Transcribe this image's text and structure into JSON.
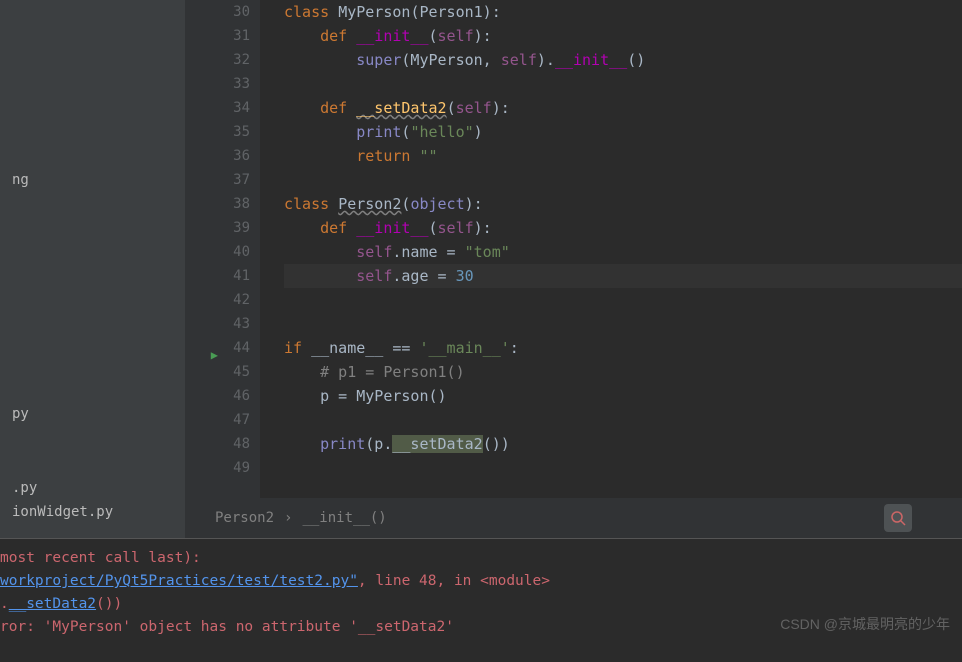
{
  "sidebar": {
    "items": [
      "",
      "",
      "",
      "",
      "",
      "",
      "",
      "ng",
      "",
      "",
      "",
      "",
      "",
      "",
      "",
      "",
      "",
      "py",
      "",
      "",
      ".py",
      "ionWidget.py"
    ]
  },
  "gutter": {
    "lines": [
      "30",
      "31",
      "32",
      "33",
      "34",
      "35",
      "36",
      "37",
      "38",
      "39",
      "40",
      "41",
      "42",
      "43",
      "44",
      "45",
      "46",
      "47",
      "48",
      "49"
    ]
  },
  "code": {
    "lines": [
      {
        "n": 30,
        "tokens": [
          {
            "t": "class ",
            "c": "keyword"
          },
          {
            "t": "MyPerson",
            "c": "class-name"
          },
          {
            "t": "(Person1):",
            "c": "paren"
          }
        ]
      },
      {
        "n": 31,
        "tokens": [
          {
            "t": "    ",
            "c": ""
          },
          {
            "t": "def ",
            "c": "keyword"
          },
          {
            "t": "__init__",
            "c": "dunder"
          },
          {
            "t": "(",
            "c": "paren"
          },
          {
            "t": "self",
            "c": "self-param"
          },
          {
            "t": "):",
            "c": "paren"
          }
        ]
      },
      {
        "n": 32,
        "tokens": [
          {
            "t": "        ",
            "c": ""
          },
          {
            "t": "super",
            "c": "builtin"
          },
          {
            "t": "(MyPerson, ",
            "c": "paren"
          },
          {
            "t": "self",
            "c": "self-param"
          },
          {
            "t": ").",
            "c": "paren"
          },
          {
            "t": "__init__",
            "c": "dunder"
          },
          {
            "t": "()",
            "c": "paren"
          }
        ]
      },
      {
        "n": 33,
        "tokens": []
      },
      {
        "n": 34,
        "tokens": [
          {
            "t": "    ",
            "c": ""
          },
          {
            "t": "def ",
            "c": "keyword"
          },
          {
            "t": "__setData2",
            "c": "method-name underline-wavy"
          },
          {
            "t": "(",
            "c": "paren"
          },
          {
            "t": "self",
            "c": "self-param"
          },
          {
            "t": "):",
            "c": "paren"
          }
        ]
      },
      {
        "n": 35,
        "tokens": [
          {
            "t": "        ",
            "c": ""
          },
          {
            "t": "print",
            "c": "builtin"
          },
          {
            "t": "(",
            "c": "paren"
          },
          {
            "t": "\"hello\"",
            "c": "string"
          },
          {
            "t": ")",
            "c": "paren"
          }
        ]
      },
      {
        "n": 36,
        "tokens": [
          {
            "t": "        ",
            "c": ""
          },
          {
            "t": "return ",
            "c": "keyword"
          },
          {
            "t": "\"\"",
            "c": "string"
          }
        ]
      },
      {
        "n": 37,
        "tokens": []
      },
      {
        "n": 38,
        "tokens": [
          {
            "t": "class ",
            "c": "keyword"
          },
          {
            "t": "Person2",
            "c": "class-name underline-wavy"
          },
          {
            "t": "(",
            "c": "paren"
          },
          {
            "t": "object",
            "c": "builtin"
          },
          {
            "t": "):",
            "c": "paren"
          }
        ]
      },
      {
        "n": 39,
        "tokens": [
          {
            "t": "    ",
            "c": ""
          },
          {
            "t": "def ",
            "c": "keyword"
          },
          {
            "t": "__init__",
            "c": "dunder"
          },
          {
            "t": "(",
            "c": "paren"
          },
          {
            "t": "self",
            "c": "self-param"
          },
          {
            "t": "):",
            "c": "paren"
          }
        ]
      },
      {
        "n": 40,
        "tokens": [
          {
            "t": "        ",
            "c": ""
          },
          {
            "t": "self",
            "c": "self-param"
          },
          {
            "t": ".name = ",
            "c": "operator"
          },
          {
            "t": "\"tom\"",
            "c": "string"
          }
        ]
      },
      {
        "n": 41,
        "tokens": [
          {
            "t": "        ",
            "c": ""
          },
          {
            "t": "self",
            "c": "self-param"
          },
          {
            "t": ".age = ",
            "c": "operator"
          },
          {
            "t": "30",
            "c": "number"
          }
        ],
        "current": true
      },
      {
        "n": 42,
        "tokens": []
      },
      {
        "n": 43,
        "tokens": []
      },
      {
        "n": 44,
        "tokens": [
          {
            "t": "if ",
            "c": "keyword"
          },
          {
            "t": "__name__ == ",
            "c": "operator"
          },
          {
            "t": "'__main__'",
            "c": "string"
          },
          {
            "t": ":",
            "c": "paren"
          }
        ],
        "run": true
      },
      {
        "n": 45,
        "tokens": [
          {
            "t": "    ",
            "c": ""
          },
          {
            "t": "# p1 = Person1()",
            "c": "comment"
          }
        ]
      },
      {
        "n": 46,
        "tokens": [
          {
            "t": "    p = MyPerson()",
            "c": "operator"
          }
        ]
      },
      {
        "n": 47,
        "tokens": []
      },
      {
        "n": 48,
        "tokens": [
          {
            "t": "    ",
            "c": ""
          },
          {
            "t": "print",
            "c": "builtin"
          },
          {
            "t": "(p.",
            "c": "paren"
          },
          {
            "t": "__setData2",
            "c": "highlight-bg"
          },
          {
            "t": "())",
            "c": "paren"
          }
        ]
      },
      {
        "n": 49,
        "tokens": []
      }
    ]
  },
  "breadcrumb": {
    "parts": [
      "Person2",
      "›",
      "__init__()"
    ]
  },
  "console": {
    "lines": [
      {
        "tokens": [
          {
            "t": "most recent call last):",
            "c": "error-text"
          }
        ]
      },
      {
        "tokens": [
          {
            "t": "workproject/PyQt5Practices/test/test2.py\"",
            "c": "link-text"
          },
          {
            "t": ", line 48, in <module>",
            "c": "error-text"
          }
        ]
      },
      {
        "tokens": [
          {
            "t": ".",
            "c": "error-text"
          },
          {
            "t": "__setData2",
            "c": "link-text"
          },
          {
            "t": "())",
            "c": "error-text"
          }
        ]
      },
      {
        "tokens": [
          {
            "t": "ror: 'MyPerson' object has no attribute '__setData2'",
            "c": "error-text"
          }
        ]
      }
    ]
  },
  "watermark": "CSDN @京城最明亮的少年"
}
